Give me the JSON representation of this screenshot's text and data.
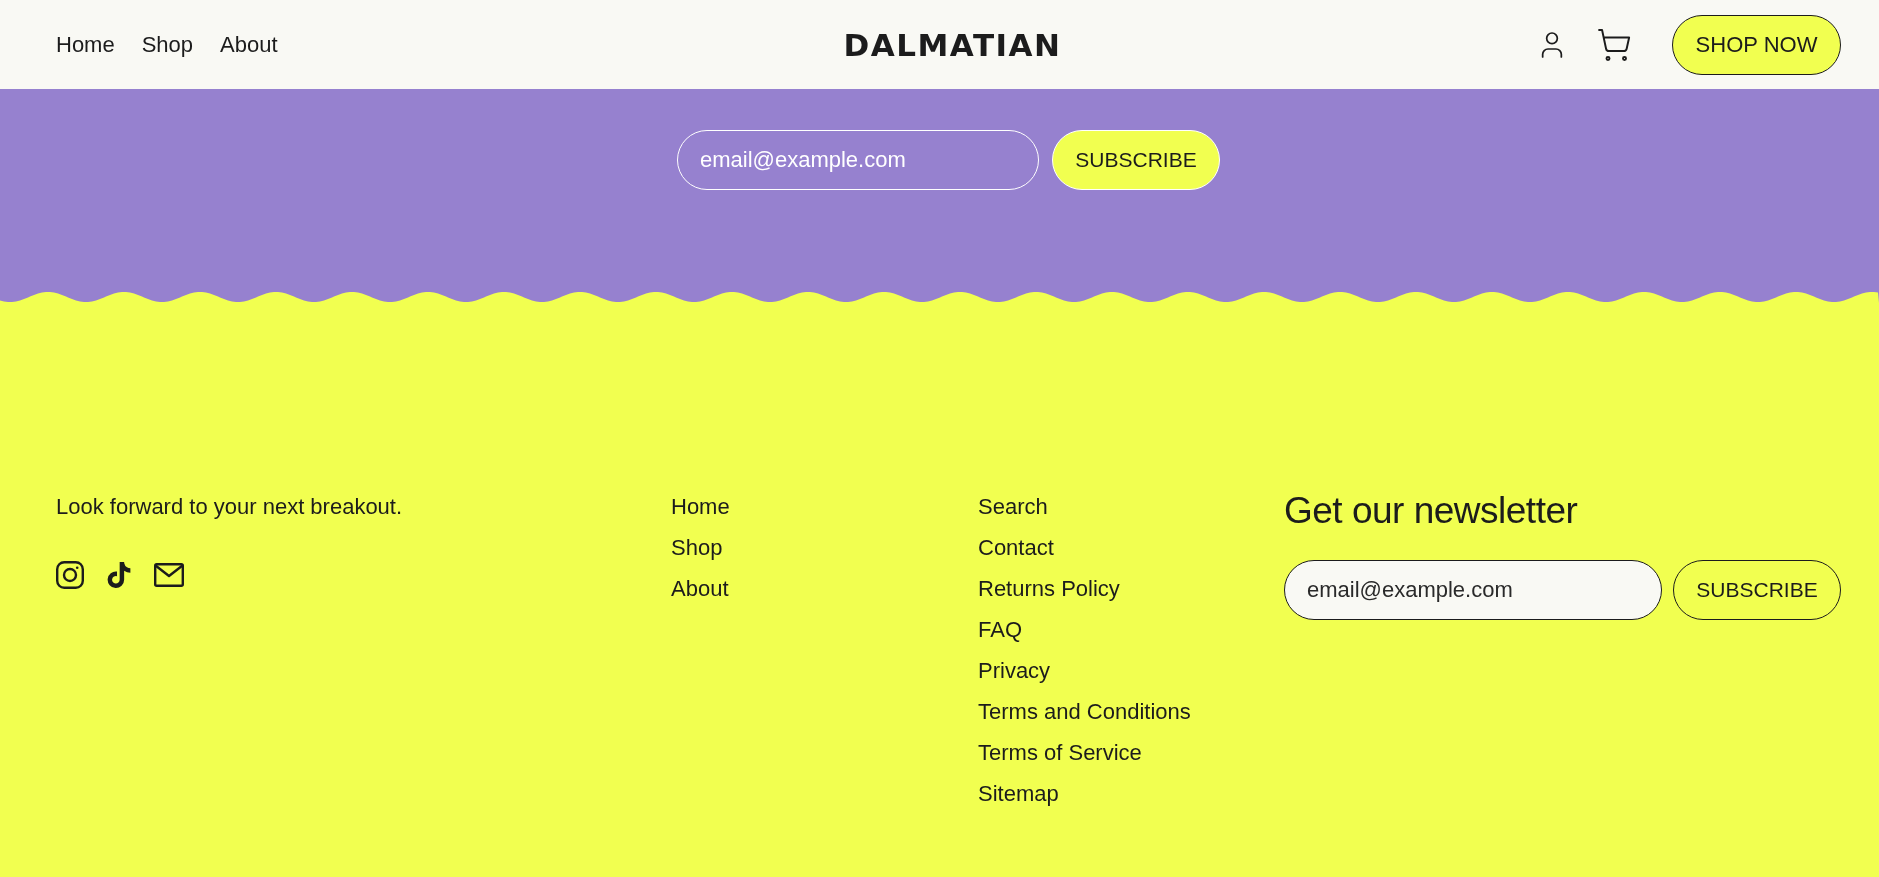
{
  "header": {
    "nav": [
      "Home",
      "Shop",
      "About"
    ],
    "logo": "DALMATIAN",
    "cta": "SHOP NOW"
  },
  "signup": {
    "placeholder": "email@example.com",
    "button": "SUBSCRIBE"
  },
  "footer": {
    "tagline": "Look forward to your next breakout.",
    "links_1": [
      "Home",
      "Shop",
      "About"
    ],
    "links_2": [
      "Search",
      "Contact",
      "Returns Policy",
      "FAQ",
      "Privacy",
      "Terms and Conditions",
      "Terms of Service",
      "Sitemap"
    ],
    "newsletter": {
      "heading": "Get our newsletter",
      "placeholder": "email@example.com",
      "button": "SUBSCRIBE"
    }
  }
}
